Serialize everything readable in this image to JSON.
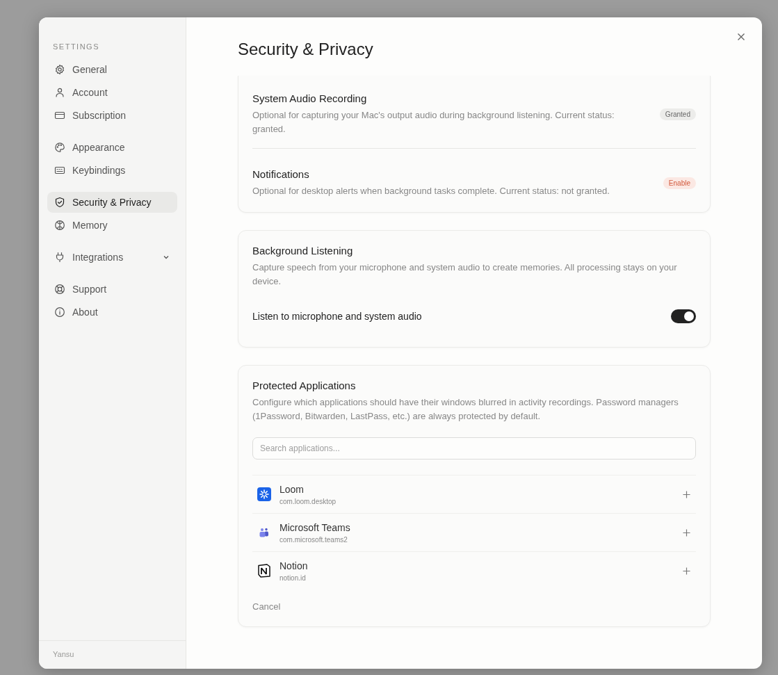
{
  "sidebar": {
    "heading": "SETTINGS",
    "groups": [
      [
        {
          "label": "General",
          "selected": false
        },
        {
          "label": "Account",
          "selected": false
        },
        {
          "label": "Subscription",
          "selected": false
        }
      ],
      [
        {
          "label": "Appearance",
          "selected": false
        },
        {
          "label": "Keybindings",
          "selected": false
        }
      ],
      [
        {
          "label": "Security & Privacy",
          "selected": true
        },
        {
          "label": "Memory",
          "selected": false
        }
      ],
      [
        {
          "label": "Integrations",
          "selected": false,
          "expanded": false
        }
      ],
      [
        {
          "label": "Support",
          "selected": false
        },
        {
          "label": "About",
          "selected": false
        }
      ]
    ],
    "footer": "Yansu"
  },
  "title": "Security & Privacy",
  "permissions": [
    {
      "title": "System Audio Recording",
      "description": "Optional for capturing your Mac's output audio during background listening. Current status: granted.",
      "badge": {
        "label": "Granted",
        "kind": "status"
      }
    },
    {
      "title": "Notifications",
      "description": "Optional for desktop alerts when background tasks complete. Current status: not granted.",
      "badge": {
        "label": "Enable",
        "kind": "action"
      }
    }
  ],
  "background_listening": {
    "title": "Background Listening",
    "description": "Capture speech from your microphone and system audio to create memories. All processing stays on your device.",
    "toggle": {
      "label": "Listen to microphone and system audio",
      "on": true
    }
  },
  "protected_applications": {
    "title": "Protected Applications",
    "description": "Configure which applications should have their windows blurred in activity recordings. Password managers (1Password, Bitwarden, LastPass, etc.) are always protected by default.",
    "search": {
      "placeholder": "Search applications..."
    },
    "apps": [
      {
        "name": "Loom",
        "bundle": "com.loom.desktop"
      },
      {
        "name": "Microsoft Teams",
        "bundle": "com.microsoft.teams2"
      },
      {
        "name": "Notion",
        "bundle": "notion.id"
      }
    ],
    "cancel": "Cancel"
  }
}
